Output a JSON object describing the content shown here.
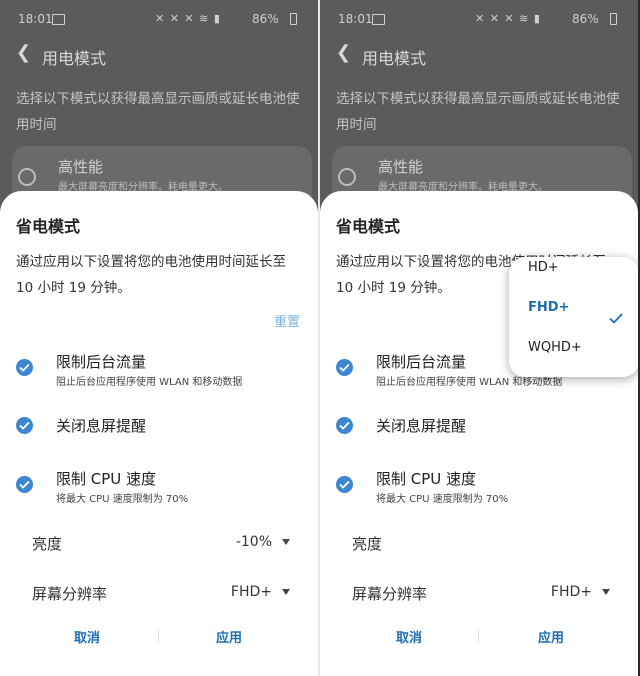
{
  "status_bar": {
    "time": "18:01",
    "icons": "✕ ✕ ✕ ≋ ▮",
    "battery": "86%"
  },
  "app_bar": {
    "title": "用电模式"
  },
  "description": "选择以下模式以获得最高显示画质或延长电池使用时间",
  "option_high_perf": {
    "title": "高性能",
    "subtitle": "最大屏幕亮度和分辨率。耗电量更大。"
  },
  "sheet": {
    "title": "省电模式",
    "description": "通过应用以下设置将您的电池使用时间延长至 10 小时 19 分钟。",
    "reset": "重置",
    "items": [
      {
        "title": "限制后台流量",
        "subtitle": "阻止后台应用程序使用 WLAN 和移动数据"
      },
      {
        "title": "关闭息屏提醒",
        "subtitle": ""
      },
      {
        "title": "限制 CPU 速度",
        "subtitle": "将最大 CPU 速度限制为 70%"
      }
    ],
    "brightness": {
      "label": "亮度",
      "value": "-10%"
    },
    "resolution": {
      "label": "屏幕分辨率",
      "value": "FHD+"
    },
    "cancel": "取消",
    "apply": "应用"
  },
  "resolution_dropdown": {
    "options": [
      "HD+",
      "FHD+",
      "WQHD+"
    ],
    "selected": "FHD+"
  },
  "colors": {
    "accent": "#3e87d0",
    "button_text": "#1e6db3",
    "reset": "#7fb1d8",
    "dim_background": "#5b5b5b"
  }
}
